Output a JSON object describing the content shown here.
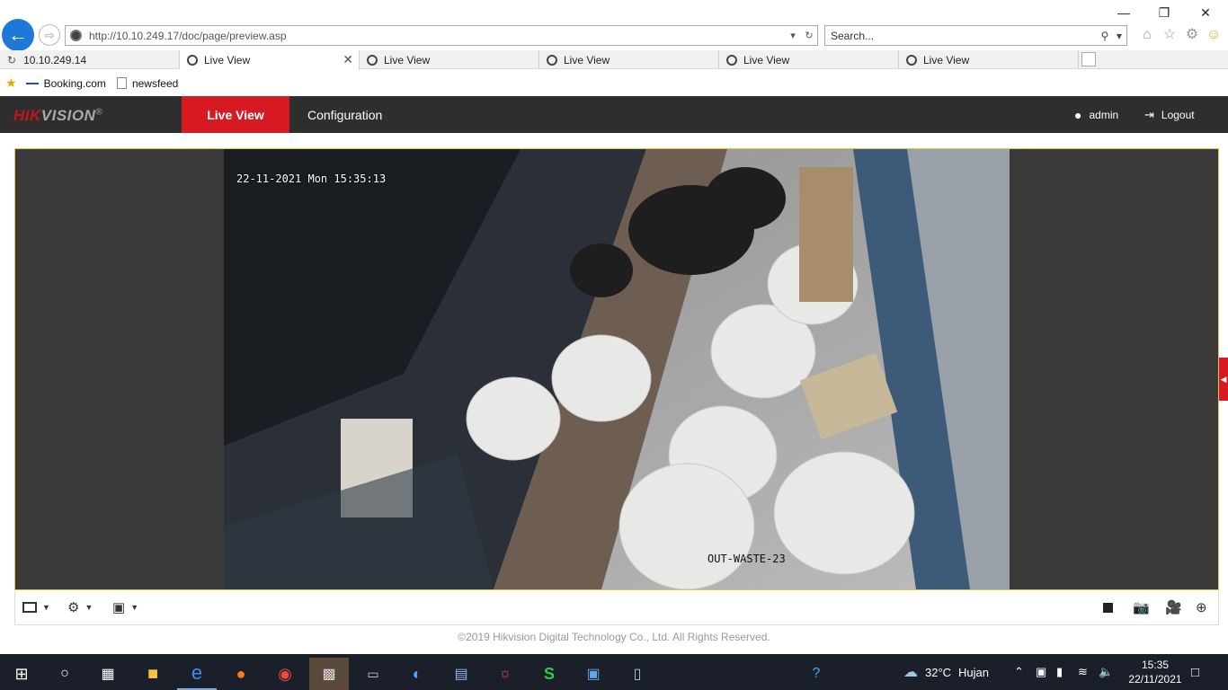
{
  "browser": {
    "url": "http://10.10.249.17/doc/page/preview.asp",
    "search_placeholder": "Search...",
    "tabs": [
      {
        "label": "10.10.249.14",
        "active": false
      },
      {
        "label": "Live View",
        "active": true
      },
      {
        "label": "Live View",
        "active": false
      },
      {
        "label": "Live View",
        "active": false
      },
      {
        "label": "Live View",
        "active": false
      },
      {
        "label": "Live View",
        "active": false
      }
    ],
    "favorites": [
      {
        "label": "Booking.com",
        "icon": "booking-icon"
      },
      {
        "label": "newsfeed",
        "icon": "page-icon"
      }
    ]
  },
  "app": {
    "logo_red": "HIK",
    "logo_rest": "VISION",
    "logo_mark": "®",
    "nav_live": "Live View",
    "nav_config": "Configuration",
    "user": "admin",
    "logout": "Logout",
    "brand_color": "#d71921"
  },
  "video": {
    "timestamp": "22-11-2021 Mon 15:35:13",
    "camera_name": "OUT-WASTE-23"
  },
  "footer": {
    "copyright": "©2019 Hikvision Digital Technology Co., Ltd. All Rights Reserved."
  },
  "taskbar": {
    "weather_temp": "32°C",
    "weather_text": "Hujan",
    "time": "15:35",
    "date": "22/11/2021"
  }
}
